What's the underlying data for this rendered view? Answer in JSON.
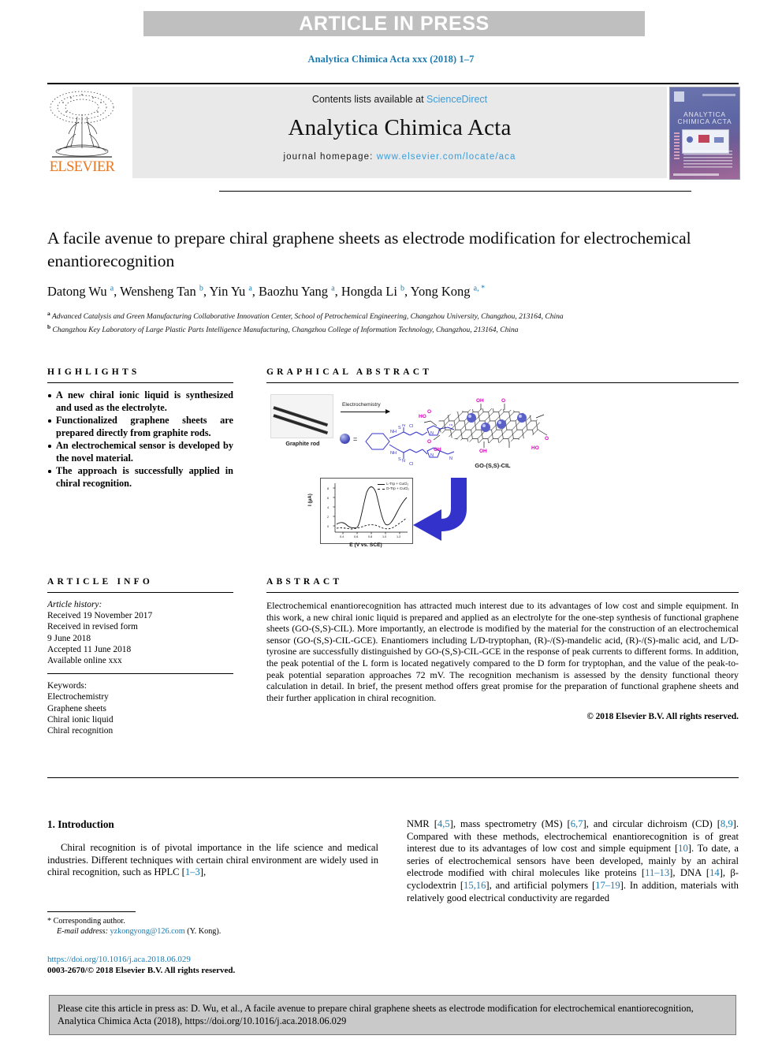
{
  "banner": {
    "text": "ARTICLE IN PRESS"
  },
  "running_head": "Analytica Chimica Acta xxx (2018) 1–7",
  "masthead": {
    "contents_prefix": "Contents lists available at ",
    "contents_link": "ScienceDirect",
    "journal_title": "Analytica Chimica Acta",
    "homepage_prefix": "journal homepage: ",
    "homepage_link": "www.elsevier.com/locate/aca",
    "publisher_logo_text": "ELSEVIER",
    "cover_journal_name": "ANALYTICA CHIMICA ACTA"
  },
  "article": {
    "title": "A facile avenue to prepare chiral graphene sheets as electrode modification for electrochemical enantiorecognition",
    "authors_html": "Datong Wu <sup>a</sup>, Wensheng Tan <sup>b</sup>, Yin Yu <sup>a</sup>, Baozhu Yang <sup>a</sup>, Hongda Li <sup>b</sup>, Yong Kong <sup>a, *</sup>",
    "affiliation_a": "Advanced Catalysis and Green Manufacturing Collaborative Innovation Center, School of Petrochemical Engineering, Changzhou University, Changzhou, 213164, China",
    "affiliation_b": "Changzhou Key Laboratory of Large Plastic Parts Intelligence Manufacturing, Changzhou College of Information Technology, Changzhou, 213164, China"
  },
  "highlights": {
    "heading": "HIGHLIGHTS",
    "items": [
      "A new chiral ionic liquid is synthesized and used as the electrolyte.",
      "Functionalized graphene sheets are prepared directly from graphite rods.",
      "An electrochemical sensor is developed by the novel material.",
      "The approach is successfully applied in chiral recognition."
    ]
  },
  "graphical_abstract": {
    "heading": "GRAPHICAL ABSTRACT",
    "rod_label": "Graphite rod",
    "arrow_label": "Electrochemistry",
    "equals_sign": "=",
    "product_label": "GO-(S,S)-CIL",
    "plot": {
      "xlabel": "E (V vs. SCE)",
      "ylabel": "I (μA)",
      "legend": [
        "L-Trp + CuCl₂",
        "D-Trp + CuCl₂"
      ]
    }
  },
  "article_info": {
    "heading": "ARTICLE INFO",
    "history_label": "Article history:",
    "history": [
      "Received 19 November 2017",
      "Received in revised form",
      "9 June 2018",
      "Accepted 11 June 2018",
      "Available online xxx"
    ],
    "keywords_label": "Keywords:",
    "keywords": [
      "Electrochemistry",
      "Graphene sheets",
      "Chiral ionic liquid",
      "Chiral recognition"
    ]
  },
  "abstract": {
    "heading": "ABSTRACT",
    "text": "Electrochemical enantiorecognition has attracted much interest due to its advantages of low cost and simple equipment. In this work, a new chiral ionic liquid is prepared and applied as an electrolyte for the one-step synthesis of functional graphene sheets (GO-(S,S)-CIL). More importantly, an electrode is modified by the material for the construction of an electrochemical sensor (GO-(S,S)-CIL-GCE). Enantiomers including L/D-tryptophan, (R)-/(S)-mandelic acid, (R)-/(S)-malic acid, and L/D-tyrosine are successfully distinguished by GO-(S,S)-CIL-GCE in the response of peak currents to different forms. In addition, the peak potential of the L form is located negatively compared to the D form for tryptophan, and the value of the peak-to-peak potential separation approaches 72 mV. The recognition mechanism is assessed by the density functional theory calculation in detail. In brief, the present method offers great promise for the preparation of functional graphene sheets and their further application in chiral recognition.",
    "copyright": "© 2018 Elsevier B.V. All rights reserved."
  },
  "introduction": {
    "section_number_title": "1. Introduction",
    "left_paragraph_html": "Chiral recognition is of pivotal importance in the life science and medical industries. Different techniques with certain chiral environment are widely used in chiral recognition, such as HPLC [<span class=\"ref\">1–3</span>],",
    "right_paragraph_html": "NMR [<span class=\"ref\">4,5</span>], mass spectrometry (MS) [<span class=\"ref\">6,7</span>], and circular dichroism (CD) [<span class=\"ref\">8,9</span>]. Compared with these methods, electrochemical enantiorecognition is of great interest due to its advantages of low cost and simple equipment [<span class=\"ref\">10</span>]. To date, a series of electrochemical sensors have been developed, mainly by an achiral electrode modified with chiral molecules like proteins [<span class=\"ref\">11–13</span>], DNA [<span class=\"ref\">14</span>], β-cyclodextrin [<span class=\"ref\">15,16</span>], and artificial polymers [<span class=\"ref\">17–19</span>]. In addition, materials with relatively good electrical conductivity are regarded"
  },
  "footnote": {
    "corresponding": "* Corresponding author.",
    "email_label": "E-mail address:",
    "email": "yzkongyong@126.com",
    "email_suffix": "(Y. Kong).",
    "doi": "https://doi.org/10.1016/j.aca.2018.06.029",
    "issn_line": "0003-2670/© 2018 Elsevier B.V. All rights reserved."
  },
  "citation_box": {
    "text": "Please cite this article in press as: D. Wu, et al., A facile avenue to prepare chiral graphene sheets as electrode modification for electrochemical enantiorecognition, Analytica Chimica Acta (2018), https://doi.org/10.1016/j.aca.2018.06.029"
  },
  "colors": {
    "banner_gray": "#bfbfbf",
    "link_blue": "#3b9cd9",
    "ref_blue": "#1a7ab0",
    "elsevier_orange": "#e87722",
    "cil_blue": "#3333cc",
    "func_group_magenta": "#e000c0",
    "citation_box_gray": "#c9c9c9"
  }
}
